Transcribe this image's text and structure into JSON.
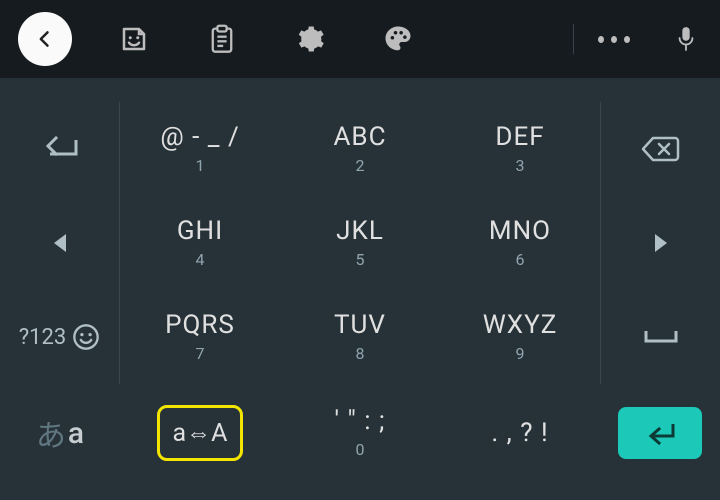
{
  "keys": {
    "r1c2_main": "@ - _ /",
    "r1c2_sub": "1",
    "r1c3_main": "ABC",
    "r1c3_sub": "2",
    "r1c4_main": "DEF",
    "r1c4_sub": "3",
    "r2c2_main": "GHI",
    "r2c2_sub": "4",
    "r2c3_main": "JKL",
    "r2c3_sub": "5",
    "r2c4_main": "MNO",
    "r2c4_sub": "6",
    "r3c1_label": "?123",
    "r3c2_main": "PQRS",
    "r3c2_sub": "7",
    "r3c3_main": "TUV",
    "r3c3_sub": "8",
    "r3c4_main": "WXYZ",
    "r3c4_sub": "9",
    "r4_lang_jp": "あ",
    "r4_lang_en": "a",
    "r4_case_label": "a⇔A",
    "r4c3_main": "' \" : ;",
    "r4c3_sub": "0",
    "r4c4_main": ". , ? !"
  }
}
